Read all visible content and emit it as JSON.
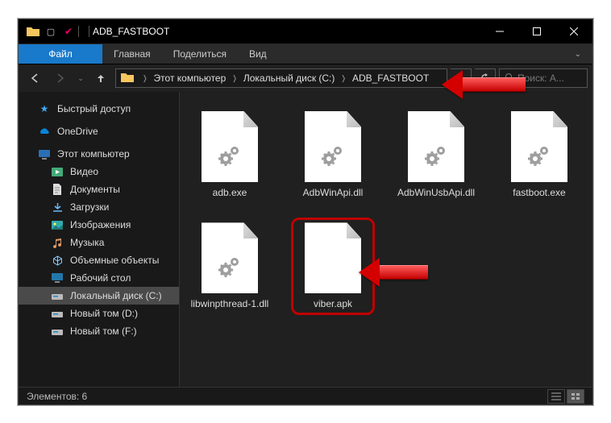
{
  "window": {
    "title": "ADB_FASTBOOT"
  },
  "ribbon": {
    "file": "Файл",
    "home": "Главная",
    "share": "Поделиться",
    "view": "Вид"
  },
  "breadcrumb": {
    "seg1": "Этот компьютер",
    "seg2": "Локальный диск (C:)",
    "seg3": "ADB_FASTBOOT"
  },
  "search": {
    "placeholder": "Поиск: A..."
  },
  "sidebar": {
    "quick": "Быстрый доступ",
    "onedrive": "OneDrive",
    "thispc": "Этот компьютер",
    "videos": "Видео",
    "documents": "Документы",
    "downloads": "Загрузки",
    "pictures": "Изображения",
    "music": "Музыка",
    "objects3d": "Объемные объекты",
    "desktop": "Рабочий стол",
    "diskC": "Локальный диск (C:)",
    "diskD": "Новый том (D:)",
    "diskF": "Новый том (F:)"
  },
  "files": [
    {
      "name": "adb.exe",
      "type": "exe"
    },
    {
      "name": "AdbWinApi.dll",
      "type": "dll"
    },
    {
      "name": "AdbWinUsbApi.dll",
      "type": "dll"
    },
    {
      "name": "fastboot.exe",
      "type": "exe"
    },
    {
      "name": "libwinpthread-1.dll",
      "type": "dll"
    },
    {
      "name": "viber.apk",
      "type": "blank",
      "highlight": true
    }
  ],
  "status": {
    "count_label": "Элементов: 6"
  }
}
